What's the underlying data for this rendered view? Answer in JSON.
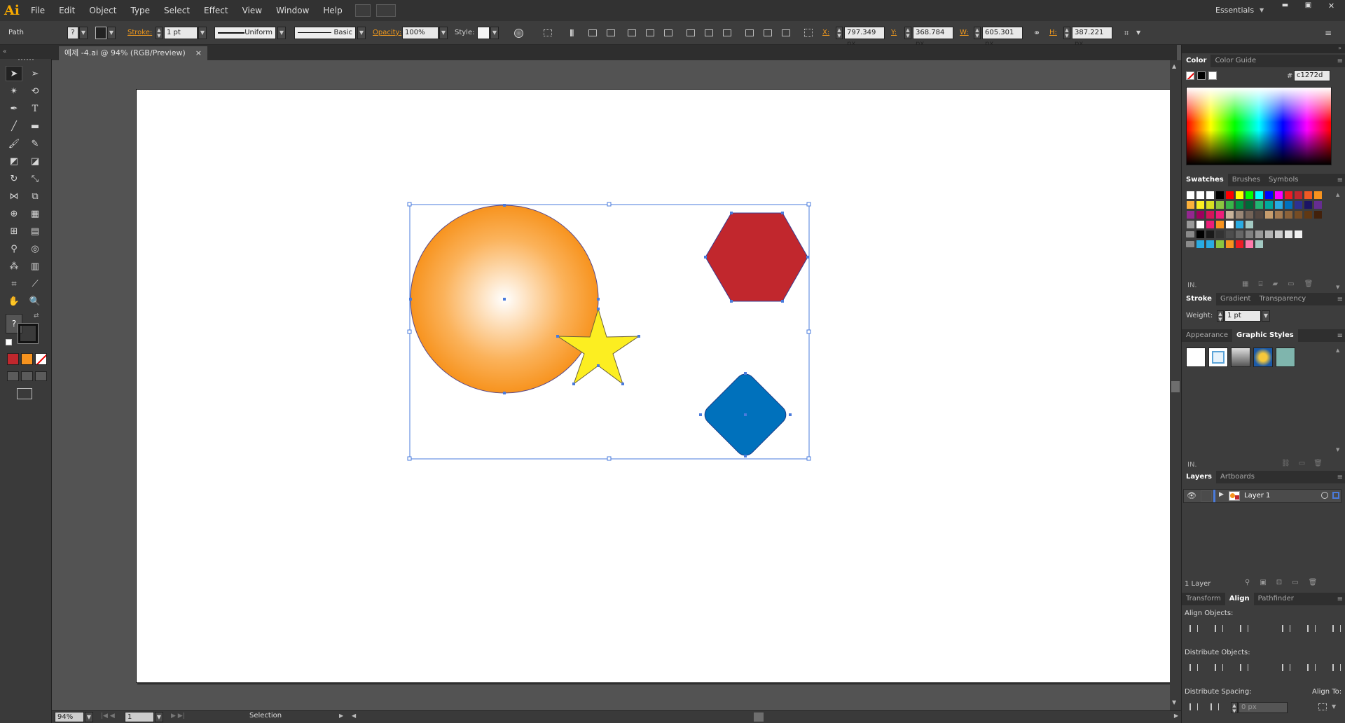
{
  "app": {
    "logo": "Ai"
  },
  "menu": {
    "items": [
      "File",
      "Edit",
      "Object",
      "Type",
      "Select",
      "Effect",
      "View",
      "Window",
      "Help"
    ],
    "workspace_label": "Essentials"
  },
  "window_controls": {
    "minimize": "▬",
    "restore": "▣",
    "close": "✕"
  },
  "control_bar": {
    "object_type": "Path",
    "fill_glyph": "?",
    "stroke_label": "Stroke:",
    "stroke_weight": "1 pt",
    "stroke_profile": "Uniform",
    "brush": "Basic",
    "opacity_label": "Opacity:",
    "opacity_value": "100%",
    "style_label": "Style:",
    "x_label": "X:",
    "x_value": "797.349 px",
    "y_label": "Y:",
    "y_value": "368.784 px",
    "w_label": "W:",
    "w_value": "605.301 px",
    "h_label": "H:",
    "h_value": "387.221 px"
  },
  "document": {
    "tab_title": "예제 -4.ai @ 94% (RGB/Preview)",
    "tab_close": "×"
  },
  "toolbox": {
    "fill_stroke_glyph": "?"
  },
  "status_bar": {
    "zoom": "94%",
    "artboard_number": "1",
    "current_tool": "Selection"
  },
  "color_panel": {
    "tabs": [
      "Color",
      "Color Guide"
    ],
    "hex_prefix": "#",
    "hex_value": "c1272d"
  },
  "swatches_panel": {
    "tabs": [
      "Swatches",
      "Brushes",
      "Symbols"
    ],
    "rows": [
      [
        "#ffffff",
        "#ffffff",
        "#ffffff",
        "#000000",
        "#ff0000",
        "#ffff00",
        "#00ff00",
        "#00ffff",
        "#0000ff",
        "#ff00ff",
        "#ed1c24",
        "#c1272d",
        "#f15a24",
        "#f7931e"
      ],
      [
        "#fbb03b",
        "#fcee21",
        "#d9e021",
        "#8cc63f",
        "#39b54a",
        "#009245",
        "#006837",
        "#22b573",
        "#00a99d",
        "#29abe2",
        "#0071bc",
        "#2e3192",
        "#1b1464",
        "#662d91"
      ],
      [
        "#93278f",
        "#9e005d",
        "#d4145a",
        "#ed1e79",
        "#c7b299",
        "#998675",
        "#736357",
        "#534741",
        "#c69c6d",
        "#a67c52",
        "#8c6239",
        "#754c24",
        "#603813",
        "#42210b"
      ],
      [
        "#999999",
        "#ffffff",
        "#ed1e79",
        "#f7931e",
        "#ffffff",
        "#29abe2",
        "#a3c9c2"
      ],
      [
        "#000000",
        "#1a1a1a",
        "#333333",
        "#4d4d4d",
        "#666666",
        "#808080",
        "#999999",
        "#b3b3b3",
        "#cccccc",
        "#e6e6e6",
        "#f2f2f2"
      ],
      [
        "#29abe2",
        "#29abe2",
        "#8cc63f",
        "#f7931e",
        "#ed1c24",
        "#ff7bac",
        "#a3c9c2"
      ]
    ]
  },
  "stroke_panel": {
    "tabs": [
      "Stroke",
      "Gradient",
      "Transparency"
    ],
    "weight_label": "Weight:",
    "weight_value": "1 pt"
  },
  "graphic_styles_panel": {
    "tabs": [
      "Appearance",
      "Graphic Styles"
    ]
  },
  "layers_panel": {
    "tabs": [
      "Layers",
      "Artboards"
    ],
    "layer_name": "Layer 1",
    "layer_count": "1 Layer"
  },
  "align_panel": {
    "tabs": [
      "Transform",
      "Align",
      "Pathfinder"
    ],
    "align_objects_label": "Align Objects:",
    "distribute_objects_label": "Distribute Objects:",
    "distribute_spacing_label": "Distribute Spacing:",
    "align_to_label": "Align To:",
    "spacing_value": "0 px"
  },
  "canvas": {
    "shapes": [
      {
        "name": "orange-gradient-circle",
        "fill": "#f7931e"
      },
      {
        "name": "yellow-star",
        "fill": "#fcee21"
      },
      {
        "name": "red-hexagon",
        "fill": "#c1272d"
      },
      {
        "name": "blue-rounded-diamond",
        "fill": "#0071bc"
      }
    ],
    "selection_color": "#4a7bdc"
  }
}
